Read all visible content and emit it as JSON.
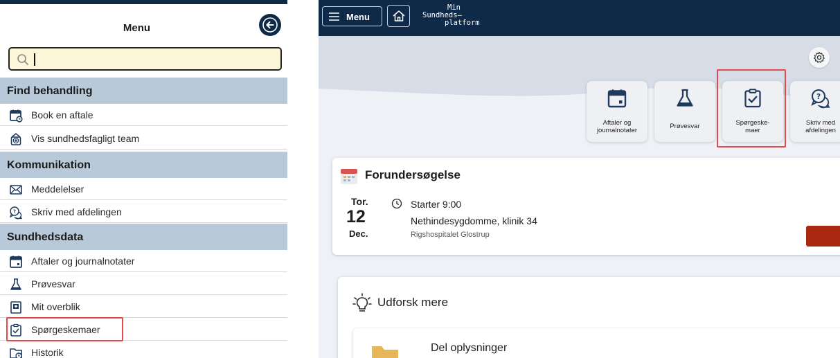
{
  "menu": {
    "title": "Menu",
    "search": {
      "value": "",
      "placeholder": ""
    },
    "sections": [
      {
        "heading": "Find behandling",
        "items": [
          {
            "label": "Book en aftale",
            "icon": "calendar-clock-icon"
          },
          {
            "label": "Vis sundhedsfagligt team",
            "icon": "medical-team-icon"
          }
        ]
      },
      {
        "heading": "Kommunikation",
        "items": [
          {
            "label": "Meddelelser",
            "icon": "envelope-icon"
          },
          {
            "label": "Skriv med afdelingen",
            "icon": "chat-bubbles-icon"
          }
        ]
      },
      {
        "heading": "Sundhedsdata",
        "items": [
          {
            "label": "Aftaler og journalnotater",
            "icon": "calendar-icon"
          },
          {
            "label": "Prøvesvar",
            "icon": "flask-icon"
          },
          {
            "label": "Mit overblik",
            "icon": "overview-icon"
          },
          {
            "label": "Spørgeskemaer",
            "icon": "clipboard-check-icon"
          },
          {
            "label": "Historik",
            "icon": "history-folder-icon"
          }
        ]
      }
    ]
  },
  "topbar": {
    "menu_label": "Menu",
    "brand_line1": "Min",
    "brand_line2": "Sundheds—",
    "brand_line3": "platform"
  },
  "tiles": [
    {
      "label_line1": "Aftaler og",
      "label_line2": "journalnotater",
      "icon": "calendar-icon"
    },
    {
      "label_line1": "Prøvesvar",
      "label_line2": "",
      "icon": "flask-icon"
    },
    {
      "label_line1": "Spørgeske-",
      "label_line2": "maer",
      "icon": "clipboard-check-icon"
    },
    {
      "label_line1": "Skriv med",
      "label_line2": "afdelingen",
      "icon": "chat-bubbles-icon"
    }
  ],
  "appointment": {
    "title": "Forundersøgelse",
    "day": "Tor.",
    "date": "12",
    "month": "Dec.",
    "start": "Starter 9:00",
    "clinic": "Nethindesygdomme, klinik 34",
    "hospital": "Rigshospitalet Glostrup"
  },
  "explore": {
    "title": "Udforsk mere",
    "share_title": "Del oplysninger"
  },
  "colors": {
    "navy": "#0f2a48",
    "section_bg": "#b8cad9",
    "highlight": "#e5484d",
    "search_bg": "#fdf6d8",
    "accent_red": "#a8290f"
  }
}
